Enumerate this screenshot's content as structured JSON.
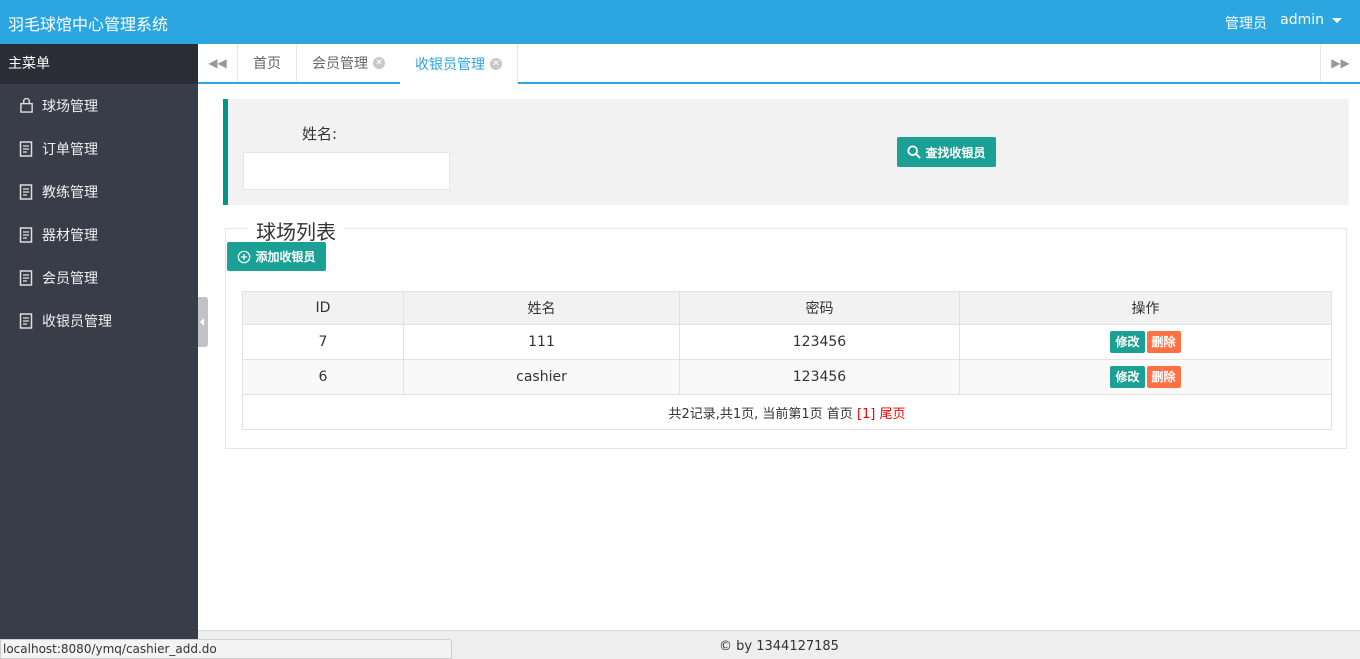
{
  "header": {
    "title": "羽毛球馆中心管理系统",
    "role": "管理员",
    "user": "admin"
  },
  "sidebar": {
    "heading": "主菜单",
    "items": [
      {
        "label": "球场管理",
        "icon": "bag-icon"
      },
      {
        "label": "订单管理",
        "icon": "document-icon"
      },
      {
        "label": "教练管理",
        "icon": "document-icon"
      },
      {
        "label": "器材管理",
        "icon": "document-icon"
      },
      {
        "label": "会员管理",
        "icon": "document-icon"
      },
      {
        "label": "收银员管理",
        "icon": "document-icon"
      }
    ]
  },
  "tabs": [
    {
      "label": "首页",
      "closable": false
    },
    {
      "label": "会员管理",
      "closable": true
    },
    {
      "label": "收银员管理",
      "closable": true,
      "active": true
    }
  ],
  "search": {
    "name_label": "姓名:",
    "name_value": "",
    "button_label": "查找收银员"
  },
  "list": {
    "legend": "球场列表",
    "add_button_label": "添加收银员",
    "columns": [
      "ID",
      "姓名",
      "密码",
      "操作"
    ],
    "rows": [
      {
        "id": "7",
        "name": "111",
        "password": "123456"
      },
      {
        "id": "6",
        "name": "cashier",
        "password": "123456"
      }
    ],
    "edit_label": "修改",
    "delete_label": "删除",
    "pager": {
      "summary": "共2记录,共1页, 当前第1页 首页",
      "current": "[1]",
      "last": "尾页"
    }
  },
  "footer": {
    "text": "© by 1344127185"
  },
  "statusbar": {
    "url": "localhost:8080/ymq/cashier_add.do"
  },
  "colors": {
    "header_bg": "#2ba6e1",
    "sidebar_bg": "#393d49",
    "green": "#1aa094",
    "orange": "#ff7043"
  }
}
